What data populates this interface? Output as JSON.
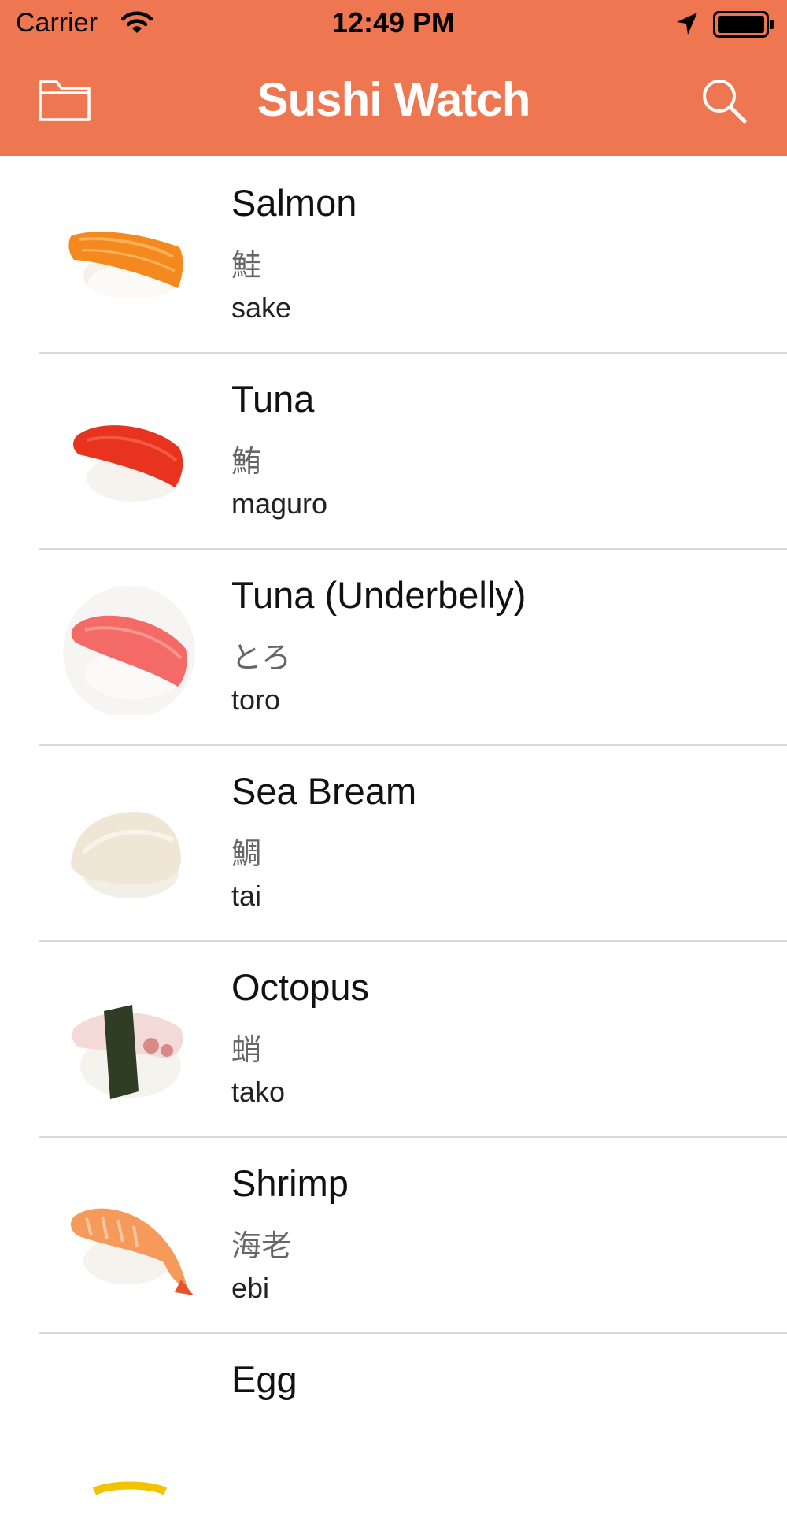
{
  "status_bar": {
    "carrier": "Carrier",
    "time": "12:49 PM",
    "icons": [
      "wifi-icon",
      "location-arrow-icon",
      "battery-icon"
    ]
  },
  "nav": {
    "title": "Sushi Watch",
    "left_icon": "folder-icon",
    "right_icon": "search-icon"
  },
  "colors": {
    "header": "#ee7651",
    "divider": "#d8d8d8"
  },
  "items": [
    {
      "name": "Salmon",
      "japanese": "鮭",
      "romaji": "sake"
    },
    {
      "name": "Tuna",
      "japanese": "鮪",
      "romaji": "maguro"
    },
    {
      "name": "Tuna (Underbelly)",
      "japanese": "とろ",
      "romaji": "toro"
    },
    {
      "name": "Sea Bream",
      "japanese": "鯛",
      "romaji": "tai"
    },
    {
      "name": "Octopus",
      "japanese": "蛸",
      "romaji": "tako"
    },
    {
      "name": "Shrimp",
      "japanese": "海老",
      "romaji": "ebi"
    },
    {
      "name": "Egg",
      "japanese": "",
      "romaji": ""
    }
  ]
}
